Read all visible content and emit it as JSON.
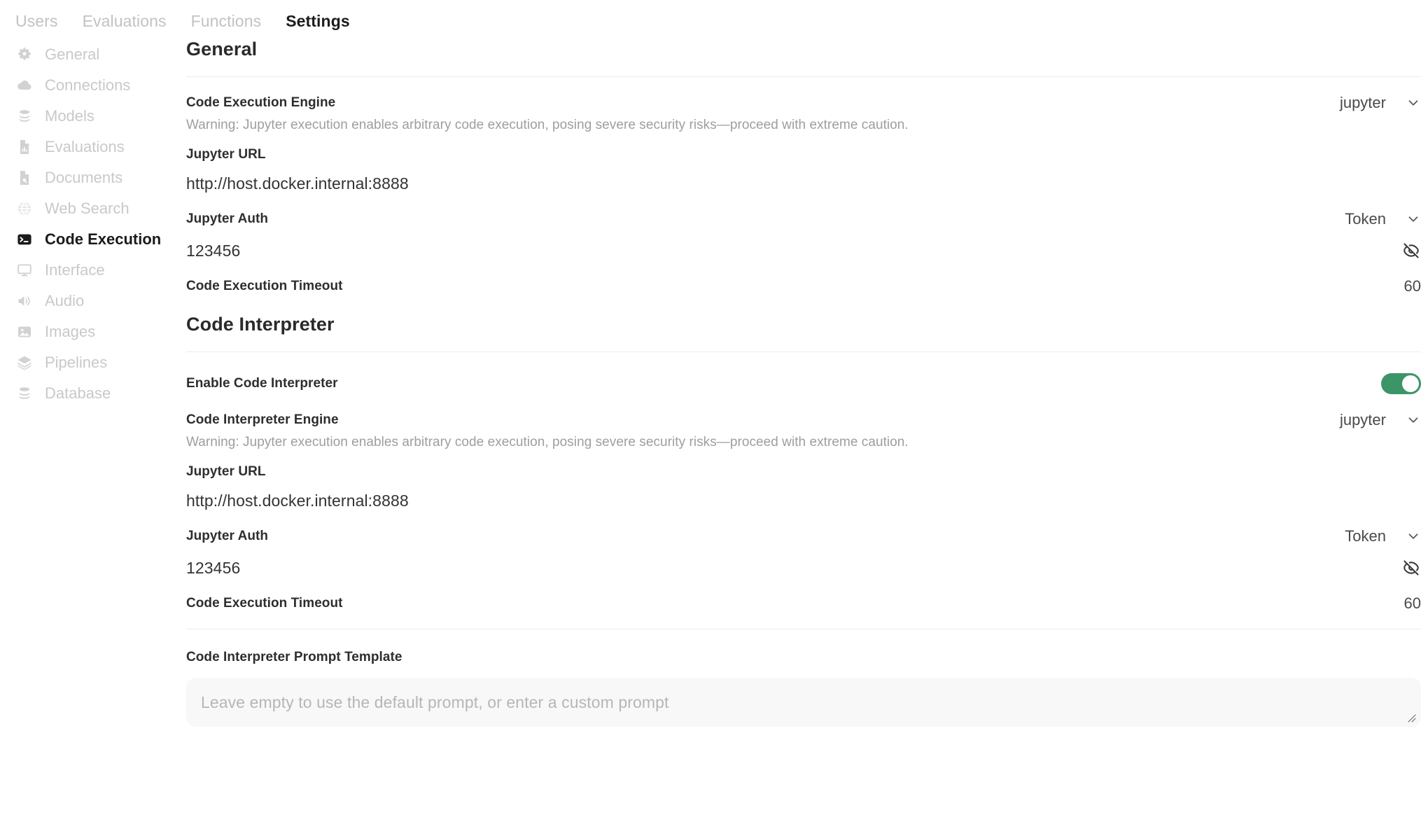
{
  "topbar": {
    "tabs": [
      {
        "label": "Users",
        "active": false
      },
      {
        "label": "Evaluations",
        "active": false
      },
      {
        "label": "Functions",
        "active": false
      },
      {
        "label": "Settings",
        "active": true
      }
    ]
  },
  "sidebar": {
    "items": [
      {
        "label": "General",
        "icon": "gear-icon",
        "active": false
      },
      {
        "label": "Connections",
        "icon": "cloud-icon",
        "active": false
      },
      {
        "label": "Models",
        "icon": "database-stack-icon",
        "active": false
      },
      {
        "label": "Evaluations",
        "icon": "document-chart-icon",
        "active": false
      },
      {
        "label": "Documents",
        "icon": "document-search-icon",
        "active": false
      },
      {
        "label": "Web Search",
        "icon": "globe-icon",
        "active": false
      },
      {
        "label": "Code Execution",
        "icon": "terminal-icon",
        "active": true
      },
      {
        "label": "Interface",
        "icon": "monitor-icon",
        "active": false
      },
      {
        "label": "Audio",
        "icon": "speaker-icon",
        "active": false
      },
      {
        "label": "Images",
        "icon": "image-icon",
        "active": false
      },
      {
        "label": "Pipelines",
        "icon": "layers-icon",
        "active": false
      },
      {
        "label": "Database",
        "icon": "database-stack-icon",
        "active": false
      }
    ]
  },
  "general": {
    "heading": "General",
    "engine_label": "Code Execution Engine",
    "engine_value": "jupyter",
    "engine_warning": "Warning: Jupyter execution enables arbitrary code execution, posing severe security risks—proceed with extreme caution.",
    "jupyter_url_label": "Jupyter URL",
    "jupyter_url_value": "http://host.docker.internal:8888",
    "jupyter_auth_label": "Jupyter Auth",
    "jupyter_auth_value": "Token",
    "token_value": "123456",
    "timeout_label": "Code Execution Timeout",
    "timeout_value": "60"
  },
  "interpreter": {
    "heading": "Code Interpreter",
    "enable_label": "Enable Code Interpreter",
    "enable_state": "on",
    "engine_label": "Code Interpreter Engine",
    "engine_value": "jupyter",
    "engine_warning": "Warning: Jupyter execution enables arbitrary code execution, posing severe security risks—proceed with extreme caution.",
    "jupyter_url_label": "Jupyter URL",
    "jupyter_url_value": "http://host.docker.internal:8888",
    "jupyter_auth_label": "Jupyter Auth",
    "jupyter_auth_value": "Token",
    "token_value": "123456",
    "timeout_label": "Code Execution Timeout",
    "timeout_value": "60",
    "prompt_template_label": "Code Interpreter Prompt Template",
    "prompt_template_placeholder": "Leave empty to use the default prompt, or enter a custom prompt",
    "prompt_template_value": ""
  },
  "colors": {
    "toggle_on": "#3c9567",
    "active_text": "#1b1b1b",
    "muted_text": "#c9c9c9",
    "hint_text": "#9e9e9e"
  }
}
